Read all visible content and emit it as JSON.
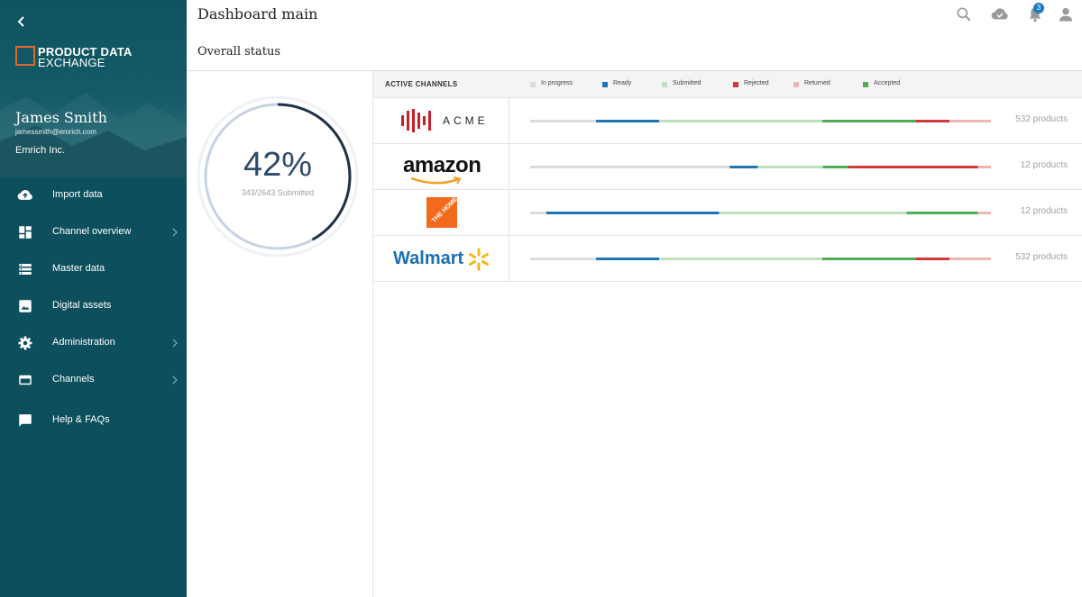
{
  "sidebar": {
    "logo": {
      "line1": "PRODUCT DATA",
      "line2": "EXCHANGE"
    },
    "user": {
      "name": "James Smith",
      "email": "jamessmith@emrich.com",
      "company": "Emrich Inc."
    },
    "items": [
      {
        "label": "Import data",
        "icon": "cloud-upload-icon",
        "chevron": false
      },
      {
        "label": "Channel overview",
        "icon": "dashboard-icon",
        "chevron": true
      },
      {
        "label": "Master data",
        "icon": "list-icon",
        "chevron": false
      },
      {
        "label": "Digital assets",
        "icon": "image-icon",
        "chevron": false
      },
      {
        "label": "Administration",
        "icon": "gear-icon",
        "chevron": true
      },
      {
        "label": "Channels",
        "icon": "credit-card-icon",
        "chevron": true
      },
      {
        "label": "Help & FAQs",
        "icon": "chat-icon",
        "chevron": false
      }
    ]
  },
  "header": {
    "title": "Dashboard main",
    "section_title": "Overall status",
    "notification_count": "3",
    "icons": [
      "search-icon",
      "cloud-check-icon",
      "bell-icon",
      "user-icon"
    ]
  },
  "overall": {
    "percent_label": "42%",
    "percent": 42,
    "submitted_text": "343/2643 Submitted"
  },
  "channels": {
    "header_title": "ACTIVE CHANNELS",
    "legend": [
      {
        "label": "In progress",
        "color": "#dcdcdc"
      },
      {
        "label": "Ready",
        "color": "#1f75b5"
      },
      {
        "label": "Submitted",
        "color": "#bfe0bf"
      },
      {
        "label": "Rejected",
        "color": "#d03a3a"
      },
      {
        "label": "Returned",
        "color": "#efb4b4"
      },
      {
        "label": "Accepted",
        "color": "#4fae54"
      }
    ],
    "rows": [
      {
        "name": "ACME",
        "count": "532 products",
        "segments": [
          {
            "status": "In progress",
            "share": 14.3
          },
          {
            "status": "Ready",
            "share": 13.7
          },
          {
            "status": "Submitted",
            "share": 35.4
          },
          {
            "status": "Accepted",
            "share": 20.2
          },
          {
            "status": "Rejected",
            "share": 7.4
          },
          {
            "status": "Returned",
            "share": 9.0
          }
        ]
      },
      {
        "name": "amazon",
        "count": "12 products",
        "segments": [
          {
            "status": "In progress",
            "share": 43.3
          },
          {
            "status": "Ready",
            "share": 6.1
          },
          {
            "status": "Submitted",
            "share": 14.1
          },
          {
            "status": "Accepted",
            "share": 5.5
          },
          {
            "status": "Rejected",
            "share": 28.2
          },
          {
            "status": "Returned",
            "share": 2.8
          }
        ]
      },
      {
        "name": "THE HOME DEPOT",
        "count": "12 products",
        "segments": [
          {
            "status": "In progress",
            "share": 3.5
          },
          {
            "status": "Ready",
            "share": 37.5
          },
          {
            "status": "Submitted",
            "share": 40.7
          },
          {
            "status": "Accepted",
            "share": 15.5
          },
          {
            "status": "Returned",
            "share": 2.8
          }
        ]
      },
      {
        "name": "Walmart",
        "count": "532 products",
        "segments": [
          {
            "status": "In progress",
            "share": 14.3
          },
          {
            "status": "Ready",
            "share": 13.7
          },
          {
            "status": "Submitted",
            "share": 35.4
          },
          {
            "status": "Accepted",
            "share": 20.2
          },
          {
            "status": "Rejected",
            "share": 7.4
          },
          {
            "status": "Returned",
            "share": 9.0
          }
        ]
      }
    ]
  }
}
